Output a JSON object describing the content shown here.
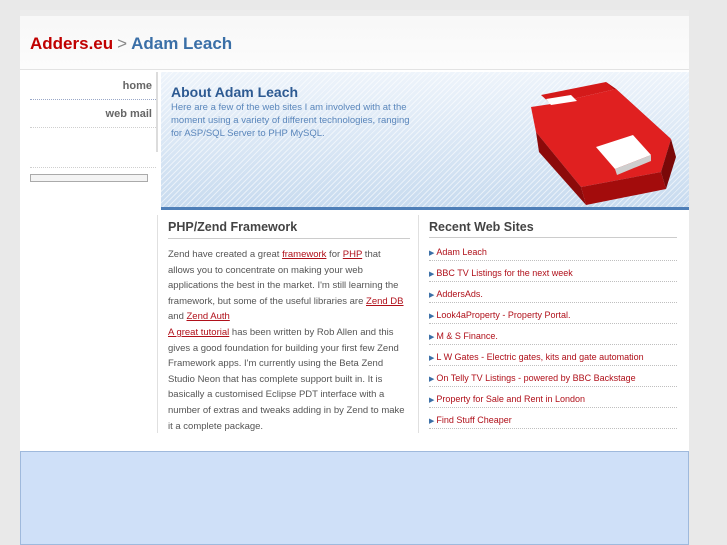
{
  "header": {
    "brand": "Adders.eu",
    "separator": ">",
    "person": "Adam Leach"
  },
  "nav": {
    "items": [
      {
        "label": "home"
      },
      {
        "label": "web mail"
      }
    ]
  },
  "banner": {
    "title": "About Adam Leach",
    "text": "Here are a few of the web sites I am involved with at the moment using a variety of different technologies, ranging for ASP/SQL Server to PHP MySQL."
  },
  "article": {
    "title": "PHP/Zend Framework",
    "p1": "Zend have created a great ",
    "link_framework": "framework",
    "p2": " for ",
    "link_php": "PHP",
    "p3": " that allows you to concentrate on making your web applications the best in the market. I'm still learning the framework, but some of the useful libraries are ",
    "link_zend_db": "Zend DB",
    "p4": " and ",
    "link_zend_auth": "Zend Auth",
    "link_tutorial": "A great tutorial",
    "p5": " has been written by Rob Allen and this gives a good foundation for building your first few Zend Framework apps. I'm currently using the Beta Zend Studio Neon that has complete support built in. It is basically a customised Eclipse PDT interface with a number of extras and tweaks adding in by Zend to make it a complete package."
  },
  "recent": {
    "title": "Recent Web Sites",
    "items": [
      "Adam Leach",
      "BBC TV Listings for the next week",
      "AddersAds.",
      "Look4aProperty - Property Portal.",
      "M & S Finance.",
      "L W Gates - Electric gates, kits and gate automation",
      "On Telly TV Listings - powered by BBC Backstage",
      "Property for Sale and Rent in London",
      "Find Stuff Cheaper"
    ]
  }
}
